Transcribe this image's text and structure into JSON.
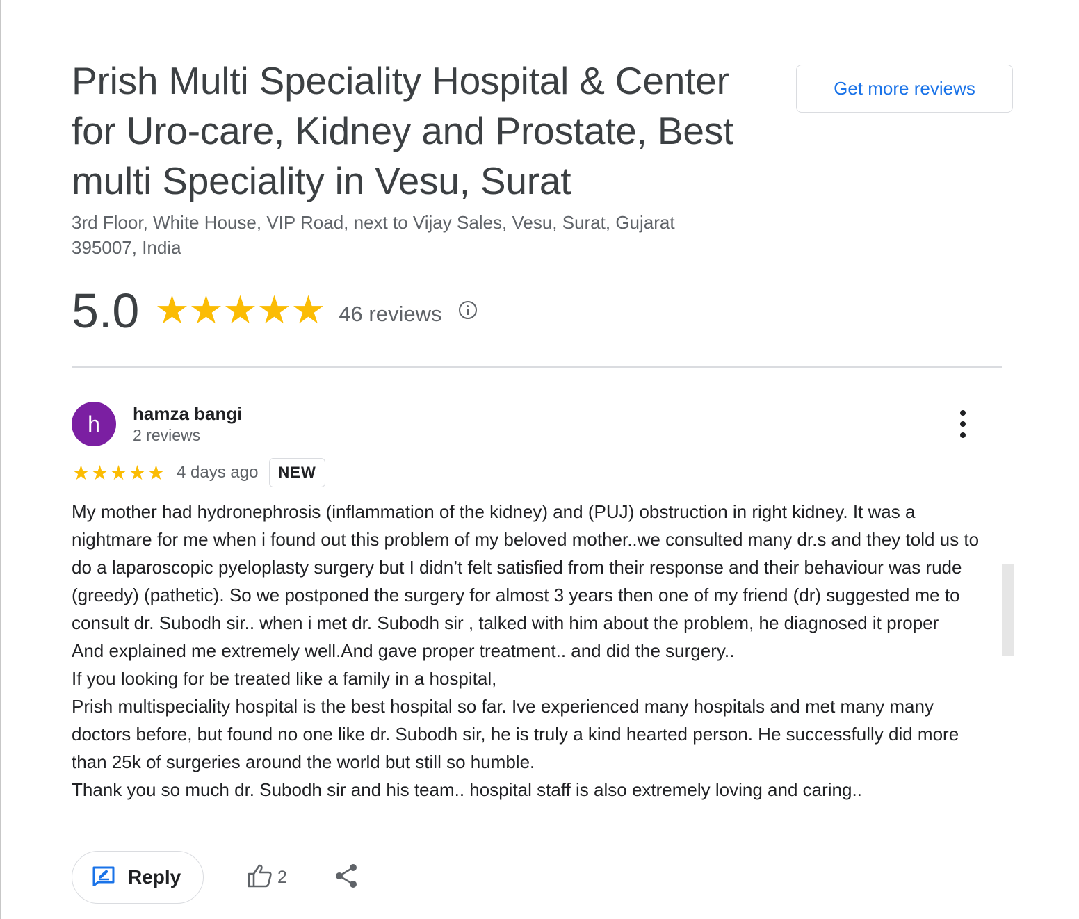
{
  "business": {
    "name": "Prish Multi Speciality Hospital & Center for Uro-care, Kidney and Prostate, Best multi Speciality in Vesu, Surat",
    "address": "3rd Floor, White House, VIP Road, next to Vijay Sales, Vesu, Surat, Gujarat 395007, India"
  },
  "header": {
    "get_more_reviews_label": "Get more reviews"
  },
  "summary": {
    "rating": "5.0",
    "stars": 5,
    "total_reviews": "46 reviews",
    "info_icon": "info-icon"
  },
  "review": {
    "avatar_letter": "h",
    "avatar_color": "#7b1fa2",
    "reviewer_name": "hamza bangi",
    "reviewer_reviews": "2 reviews",
    "stars": 5,
    "date": "4 days ago",
    "badge": "NEW",
    "paragraphs": [
      "My mother had hydronephrosis (inflammation of the kidney) and (PUJ) obstruction in right kidney. It was a nightmare for me when i found out this problem of my beloved mother..we consulted many dr.s and they told us to do a laparoscopic pyeloplasty surgery but I didn’t felt satisfied from their response and their behaviour was rude (greedy) (pathetic). So we postponed the surgery for almost 3 years then one of my friend (dr) suggested me to consult dr. Subodh sir.. when i met dr. Subodh sir , talked with him about the problem, he diagnosed it proper",
      "And explained me extremely well.And gave proper treatment.. and did the surgery..",
      "If you looking for be treated like a family in a hospital,",
      "Prish multispeciality hospital is the best hospital so far. Ive experienced many hospitals and met many many doctors before, but found no one like dr. Subodh sir, he is truly a kind hearted person. He successfully did more than 25k of surgeries around the world but still so humble.",
      "Thank you so much dr. Subodh sir and his team.. hospital staff is also extremely loving and caring.."
    ]
  },
  "actions": {
    "reply_label": "Reply",
    "like_count": "2"
  },
  "colors": {
    "accent": "#1a73e8",
    "star": "#fbbc04",
    "text": "#202124",
    "muted": "#5f6368"
  }
}
